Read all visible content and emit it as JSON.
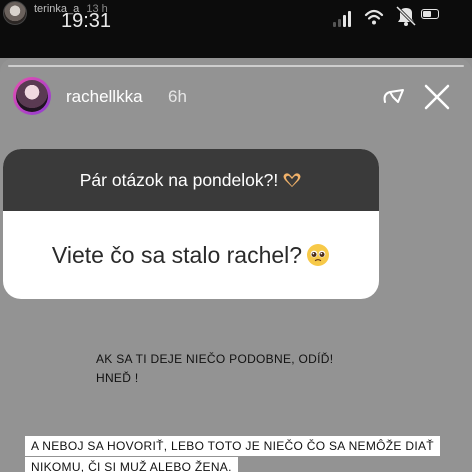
{
  "outer": {
    "username": "terinka_a",
    "time_ago": "13 h"
  },
  "status_bar": {
    "time": "19:31",
    "icons": [
      "signal-icon",
      "wifi-icon",
      "mute-icon",
      "battery-icon"
    ]
  },
  "story": {
    "username": "rachellkka",
    "time_ago": "6h",
    "question_header": "Pár otázok na pondelok?!",
    "question_header_emoji": "heart-hands-emoji",
    "question": "Viete čo sa stalo rachel?",
    "question_emoji": "pleading-face-emoji",
    "answer_1_line_1": "AK SA TI DEJE NIEČO PODOBNE, ODÍĎ!",
    "answer_1_line_2": "HNEĎ !",
    "answer_2_line_1": "A NEBOJ SA HOVORIŤ, LEBO TOTO JE NIEČO ČO SA NEMÔŽE DIAŤ",
    "answer_2_line_2": "NIKOMU, ČI SI MUŽ ALEBO ŽENA."
  },
  "colors": {
    "top_bar": "#0c0c0c",
    "story_bg": "#939393",
    "card_header": "#3a3a3a"
  }
}
